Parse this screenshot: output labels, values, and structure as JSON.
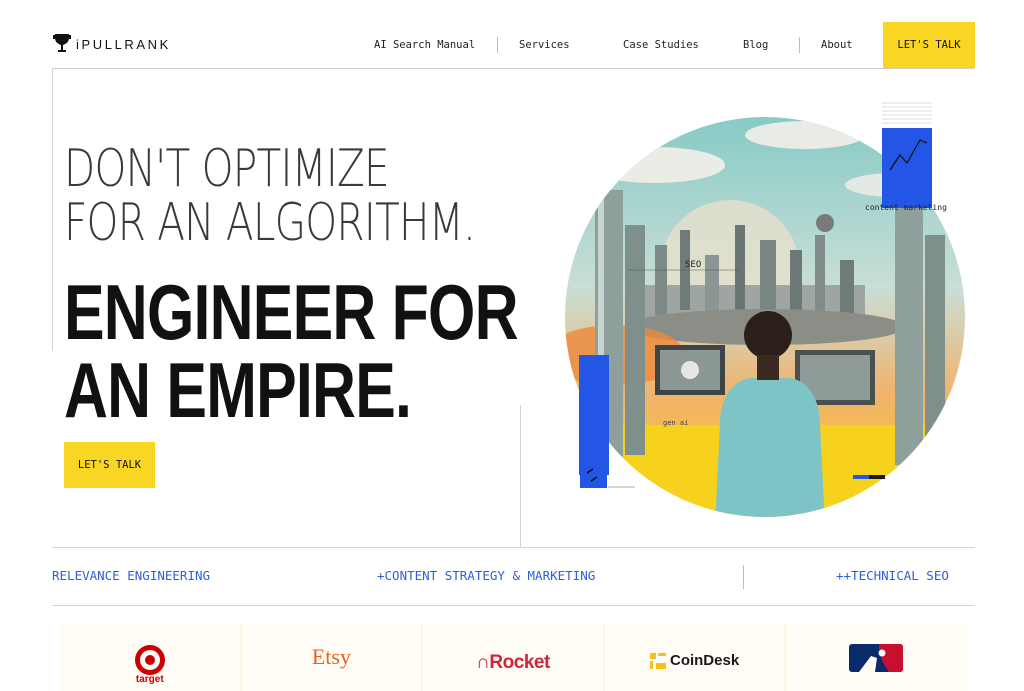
{
  "header": {
    "logo_text": "iPULLRANK",
    "nav": [
      "AI Search Manual",
      "Services",
      "Case Studies",
      "Blog",
      "About"
    ],
    "cta_label": "LET'S TALK"
  },
  "hero": {
    "line1": "DON'T OPTIMIZE",
    "line2": "FOR AN ALGORITHM.",
    "line3": "ENGINEER FOR",
    "line4": "AN EMPIRE.",
    "cta_label": "LET'S TALK",
    "art_labels": {
      "content_marketing": "content marketing",
      "seo": "SEO",
      "gen_ai": "gen ai"
    }
  },
  "services": [
    "RELEVANCE ENGINEERING",
    "+CONTENT STRATEGY & MARKETING",
    "++TECHNICAL SEO"
  ],
  "clients": {
    "target": "target",
    "etsy": "Etsy",
    "rocket": "Rocket",
    "coindesk": "CoinDesk",
    "mlb": "MLB"
  },
  "colors": {
    "accent_yellow": "#f8d623",
    "link_blue": "#2f5fd8",
    "art_blue": "#2456e6"
  }
}
